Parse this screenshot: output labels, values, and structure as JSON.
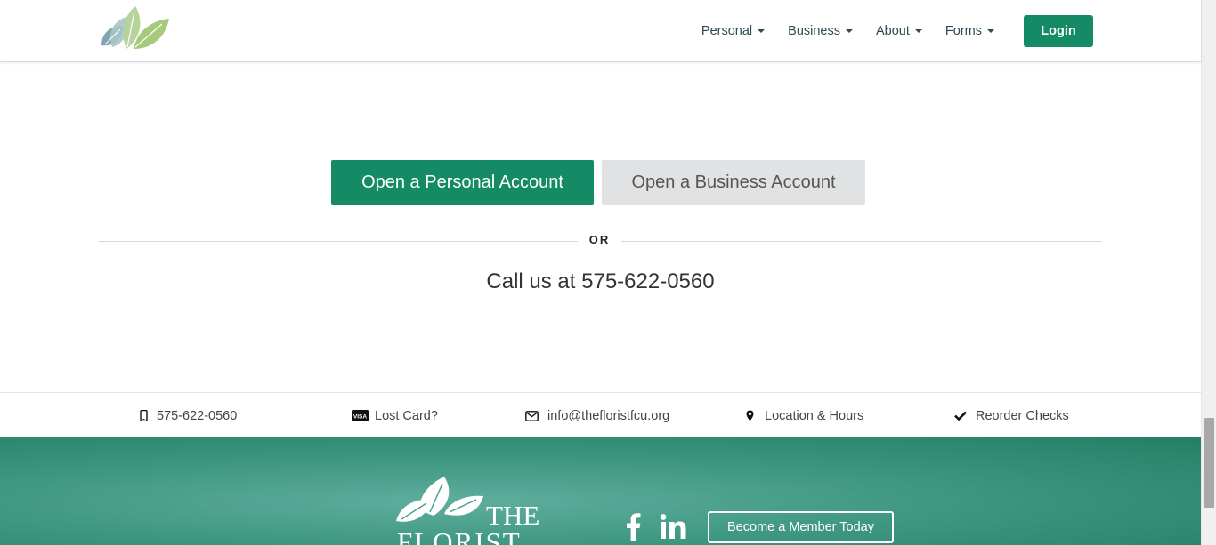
{
  "header": {
    "logo_name": "leaf-logo",
    "nav": [
      {
        "label": "Personal"
      },
      {
        "label": "Business"
      },
      {
        "label": "About"
      },
      {
        "label": "Forms"
      }
    ],
    "login_label": "Login"
  },
  "main": {
    "personal_account_label": "Open a Personal Account",
    "business_account_label": "Open a Business Account",
    "or_label": "OR",
    "call_text": "Call us at 575-622-0560"
  },
  "quick_links": [
    {
      "icon": "mobile-phone-icon",
      "label": "575-622-0560"
    },
    {
      "icon": "credit-card-icon",
      "label": "Lost Card?"
    },
    {
      "icon": "envelope-icon",
      "label": "info@thefloristfcu.org"
    },
    {
      "icon": "map-pin-icon",
      "label": "Location & Hours"
    },
    {
      "icon": "checkmark-icon",
      "label": "Reorder Checks"
    }
  ],
  "footer": {
    "logo_line1": "THE",
    "logo_line2": "FLORIST",
    "facebook_icon": "facebook-icon",
    "linkedin_icon": "linkedin-icon",
    "member_label": "Become a Member Today"
  },
  "colors": {
    "brand_green": "#148a65",
    "nav_text": "#2d4a52",
    "secondary_button": "#e1e2e4",
    "footer_green": "#3f9882"
  }
}
